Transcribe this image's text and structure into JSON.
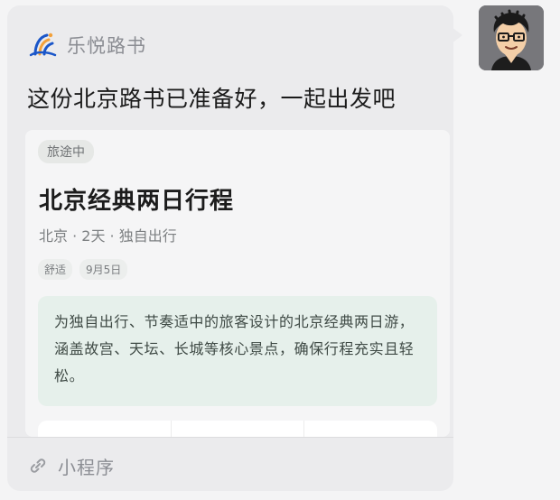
{
  "app": {
    "name": "乐悦路书",
    "logo_icon": "swirl-logo-icon",
    "brand_colors": [
      "#1a56c9",
      "#f2a03a"
    ]
  },
  "message": {
    "title": "这份北京路书已准备好，一起出发吧"
  },
  "card": {
    "status": "旅途中",
    "title": "北京经典两日行程",
    "meta": "北京 · 2天 · 独自出行",
    "tags": [
      "舒适",
      "9月5日"
    ],
    "description": "为独自出行、节奏适中的旅客设计的北京经典两日游，涵盖故宫、天坛、长城等核心景点，确保行程充实且轻松。",
    "description_bg": "#e6f0eb"
  },
  "footer": {
    "icon": "link-icon",
    "label": "小程序"
  },
  "avatar": {
    "icon": "cartoon-avatar-icon"
  }
}
